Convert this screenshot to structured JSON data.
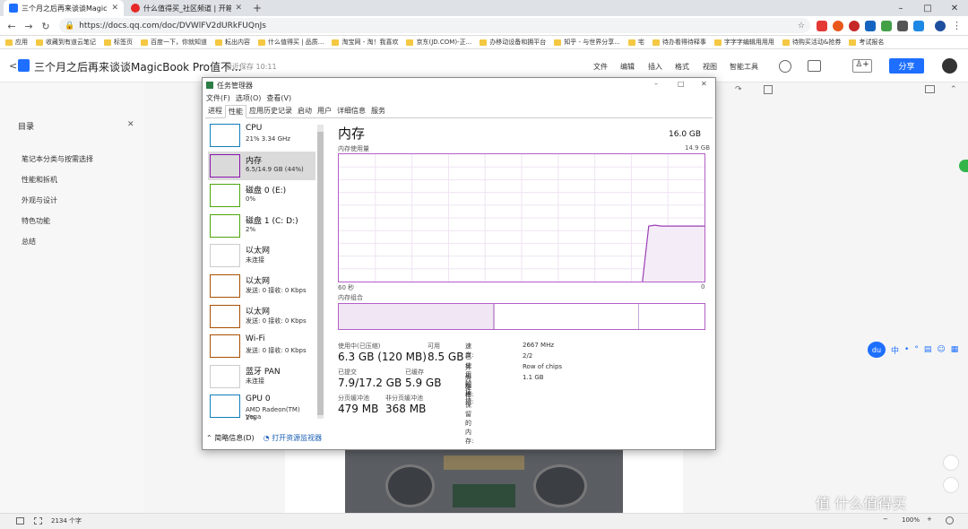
{
  "browser": {
    "tabs": [
      {
        "title": "三个月之后再来谈谈MagicBook",
        "color": "#1e6fff",
        "active": true
      },
      {
        "title": "什么值得买_社区频道 | 开箱晒物",
        "color": "#e62828",
        "active": false
      }
    ],
    "new_tab": "+",
    "window": {
      "minimize": "–",
      "maximize": "□",
      "close": "✕"
    },
    "url": "https://docs.qq.com/doc/DVWlFV2dURkFUQnJs",
    "bookmarks": [
      "应用",
      "收藏到有道云笔记",
      "标签页",
      "百度一下，你就知道",
      "耘出内容",
      "什么值得买 | 品质...",
      "淘宝网 - 淘！我喜欢",
      "京东(JD.COM)-正...",
      "办移动设备和拥平台",
      "知乎 - 与世界分享...",
      "宅",
      "待办看得待释事",
      "字字字编辑用用用",
      "待购买活动&抢券",
      "考试报名"
    ]
  },
  "doc": {
    "title": "三个月之后再来谈谈MagicBook Pro值不...",
    "saved": "最近保存 10:11",
    "menus": [
      "文件",
      "编辑",
      "插入",
      "格式",
      "视图",
      "智能工具"
    ],
    "share": "分享",
    "outline": {
      "title": "目录",
      "close": "✕",
      "items": [
        "笔记本分类与按需选择",
        "性能和拆机",
        "外观与设计",
        "特色功能",
        "总结"
      ]
    },
    "word_count": "2134 个字",
    "zoom": "100%"
  },
  "taskmgr": {
    "title": "任务管理器",
    "menu": [
      "文件(F)",
      "选项(O)",
      "查看(V)"
    ],
    "tabs": [
      "进程",
      "性能",
      "应用历史记录",
      "启动",
      "用户",
      "详细信息",
      "服务"
    ],
    "active_tab": "性能",
    "resources": [
      {
        "name": "CPU",
        "stat": "21% 3.34 GHz",
        "color": "#117dbb"
      },
      {
        "name": "内存",
        "stat": "6.5/14.9 GB (44%)",
        "color": "#8b12ae",
        "selected": true
      },
      {
        "name": "磁盘 0 (E:)",
        "stat": "0%",
        "color": "#4da60c"
      },
      {
        "name": "磁盘 1 (C: D:)",
        "stat": "2%",
        "color": "#4da60c"
      },
      {
        "name": "以太网",
        "stat": "未连接",
        "color": "#cccccc"
      },
      {
        "name": "以太网",
        "stat": "发送: 0 接收: 0 Kbps",
        "color": "#a74f01"
      },
      {
        "name": "以太网",
        "stat": "发送: 0 接收: 0 Kbps",
        "color": "#a74f01"
      },
      {
        "name": "Wi-Fi",
        "stat": "发送: 0 接收: 0 Kbps",
        "color": "#a74f01"
      },
      {
        "name": "蓝牙 PAN",
        "stat": "未连接",
        "color": "#cccccc"
      },
      {
        "name": "GPU 0",
        "stat": "AMD Radeon(TM) Vega",
        "stat2": "2%",
        "color": "#117dbb"
      }
    ],
    "footer": {
      "less": "简略信息(D)",
      "monitor": "打开资源监视器"
    },
    "memory": {
      "title": "内存",
      "total": "16.0 GB",
      "usage_label": "内存使用量",
      "usage_max": "14.9 GB",
      "time_left": "60 秒",
      "time_right": "0",
      "composition_label": "内存组合",
      "in_use_label": "使用中(已压缩)",
      "in_use": "6.3 GB (120 MB)",
      "available_label": "可用",
      "available": "8.5 GB",
      "committed_label": "已提交",
      "committed": "7.9/17.2 GB",
      "cached_label": "已缓存",
      "cached": "5.9 GB",
      "paged_label": "分页缓冲池",
      "paged": "479 MB",
      "nonpaged_label": "非分页缓冲池",
      "nonpaged": "368 MB",
      "details": [
        {
          "k": "速度:",
          "v": "2667 MHz"
        },
        {
          "k": "已使用的插槽:",
          "v": "2/2"
        },
        {
          "k": "外形规格:",
          "v": "Row of chips"
        },
        {
          "k": "为硬件保留的内存:",
          "v": "1.1 GB"
        }
      ],
      "history_gb": [
        0,
        0,
        0,
        0,
        0,
        0,
        0,
        0,
        0,
        0,
        0,
        0,
        0,
        0,
        0,
        0,
        0,
        0,
        0,
        0,
        0,
        0,
        0,
        0,
        0,
        0,
        0,
        0,
        0,
        0,
        0,
        0,
        0,
        0,
        0,
        0,
        0,
        0,
        0,
        0,
        0,
        0,
        0,
        0,
        0,
        0,
        0,
        0,
        0,
        0,
        6.5,
        6.6,
        6.5,
        6.5,
        6.5,
        6.5,
        6.5,
        6.5,
        6.5,
        6.5
      ]
    }
  },
  "float_toolbar": {
    "logo": "du",
    "items": [
      "中",
      "•",
      "°",
      "▤",
      "☺",
      "▦"
    ]
  },
  "watermark": "值 什么值得买"
}
